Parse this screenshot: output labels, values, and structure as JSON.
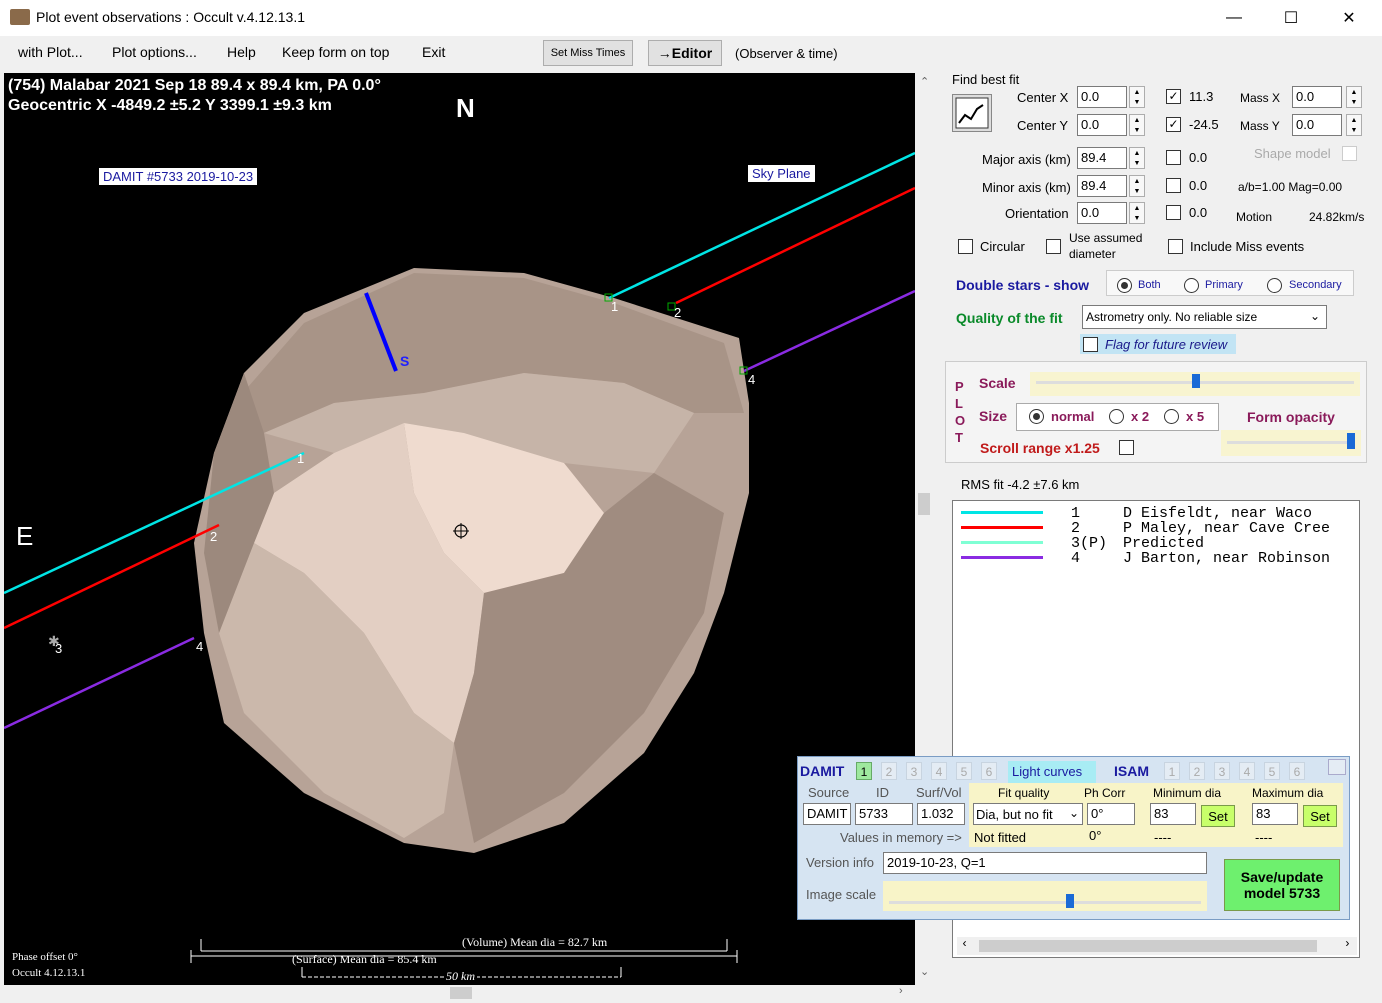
{
  "window": {
    "title": "Plot event observations : Occult v.4.12.13.1",
    "minimize": "—",
    "maximize": "☐",
    "close": "✕"
  },
  "menu": {
    "with_plot": "with Plot...",
    "plot_options": "Plot options...",
    "help": "Help",
    "keep_on_top": "Keep form on top",
    "exit": "Exit",
    "set_miss_times": "Set Miss Times",
    "editor": "→Editor",
    "observer_time": "(Observer & time)"
  },
  "plot": {
    "header_line1": "(754) Malabar  2021 Sep 18   89.4 x 89.4 km, PA 0.0°",
    "header_line2": "Geocentric  X  -4849.2 ±5.2  Y 3399.1 ±9.3 km",
    "north": "N",
    "east": "E",
    "south_marker": "S",
    "damit_label": "DAMIT #5733 2019-10-23",
    "sky_plane_label": "Sky Plane",
    "chord_labels": [
      "1",
      "2",
      "3",
      "4"
    ],
    "volume_dia": "(Volume) Mean dia = 82.7 km",
    "surface_dia": "(Surface) Mean dia = 85.4 km",
    "scale_bar": "50 km",
    "phase_offset": "Phase offset 0°",
    "version": "Occult 4.12.13.1"
  },
  "fit": {
    "find_best_fit": "Find best fit",
    "center_x_label": "Center X",
    "center_x": "0.0",
    "center_y_label": "Center Y",
    "center_y": "0.0",
    "center_x_check_val": "11.3",
    "center_y_check_val": "-24.5",
    "mass_x_label": "Mass X",
    "mass_x": "0.0",
    "mass_y_label": "Mass Y",
    "mass_y": "0.0",
    "major_label": "Major axis (km)",
    "major": "89.4",
    "minor_label": "Minor axis (km)",
    "minor": "89.4",
    "orient_label": "Orientation",
    "orient": "0.0",
    "major_check_val": "0.0",
    "minor_check_val": "0.0",
    "orient_check_val": "0.0",
    "shape_model": "Shape model",
    "ab_mag": "a/b=1.00  Mag=0.00",
    "motion_label": "Motion",
    "motion": "24.82km/s",
    "circular": "Circular",
    "use_assumed": "Use assumed",
    "diameter": "diameter",
    "include_miss": "Include Miss events",
    "double_stars": "Double stars - show",
    "both": "Both",
    "primary": "Primary",
    "secondary": "Secondary",
    "quality_label": "Quality of the fit",
    "quality_value": "Astrometry only. No reliable size",
    "flag_review": "Flag for future review"
  },
  "plotpanel": {
    "vertical": [
      "P",
      "L",
      "O",
      "T"
    ],
    "scale": "Scale",
    "size": "Size",
    "normal": "normal",
    "x2": "x 2",
    "x5": "x 5",
    "form_opacity": "Form opacity",
    "scroll_range": "Scroll range x1.25",
    "rms": "RMS fit -4.2 ±7.6 km"
  },
  "legend": [
    {
      "color": "#00e5e5",
      "num": "1",
      "name": "D Eisfeldt, near Waco"
    },
    {
      "color": "#ff0000",
      "num": "2",
      "name": "P Maley, near Cave Cree"
    },
    {
      "color": "#7fffd4",
      "num": "3(P)",
      "name": "Predicted"
    },
    {
      "color": "#8a2be2",
      "num": "4",
      "name": "J Barton, near Robinson"
    }
  ],
  "damit": {
    "damit": "DAMIT",
    "tabs": [
      "1",
      "2",
      "3",
      "4",
      "5",
      "6"
    ],
    "light_curves": "Light curves",
    "isam": "ISAM",
    "isam_tabs": [
      "1",
      "2",
      "3",
      "4",
      "5",
      "6"
    ],
    "source_label": "Source",
    "id_label": "ID",
    "surfvol_label": "Surf/Vol",
    "source": "DAMIT",
    "id": "5733",
    "surfvol": "1.032",
    "fit_quality_label": "Fit quality",
    "fit_quality": "Dia, but no fit",
    "ph_corr_label": "Ph Corr",
    "ph_corr": "0°",
    "min_dia_label": "Minimum dia",
    "min_dia": "83",
    "max_dia_label": "Maximum dia",
    "max_dia": "83",
    "set": "Set",
    "values_in_memory": "Values in memory =>",
    "mem_fit": "Not fitted",
    "mem_ph": "0°",
    "mem_min": "----",
    "mem_max": "----",
    "version_label": "Version info",
    "version": "2019-10-23, Q=1",
    "image_scale": "Image scale",
    "save": "Save/update",
    "save2": "model 5733"
  }
}
